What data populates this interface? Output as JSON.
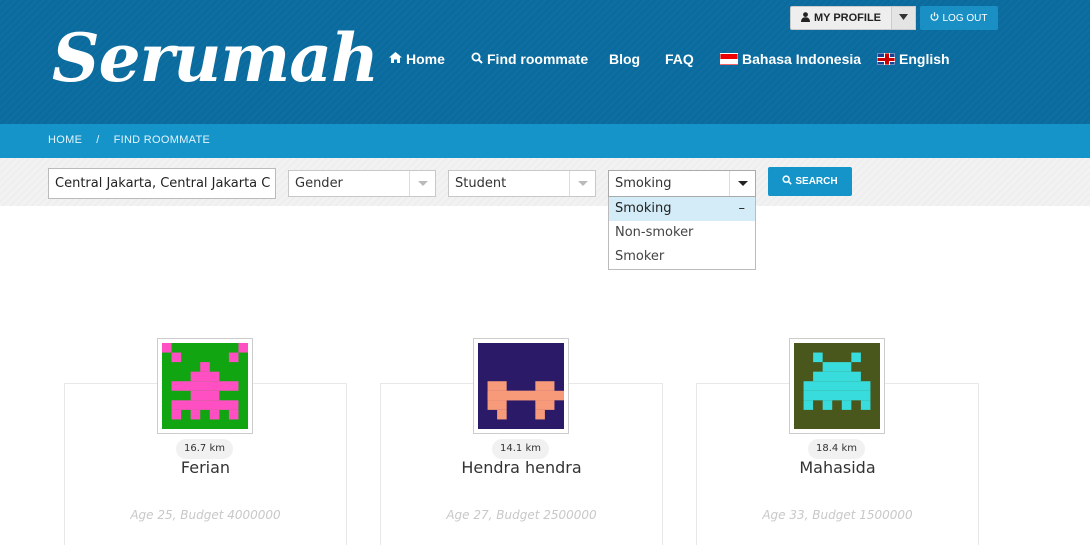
{
  "brand": {
    "logo": "Serumah"
  },
  "account": {
    "profile_label": "MY PROFILE",
    "logout_label": "LOG OUT"
  },
  "nav": {
    "home": "Home",
    "find": "Find roommate",
    "blog": "Blog",
    "faq": "FAQ",
    "lang_id": "Bahasa Indonesia",
    "lang_en": "English"
  },
  "breadcrumb": {
    "home": "HOME",
    "sep": "/",
    "current": "FIND ROOMMATE"
  },
  "filters": {
    "location_value": "Central Jakarta, Central Jakarta C",
    "gender": "Gender",
    "occupation": "Student",
    "smoking": "Smoking",
    "search_label": "SEARCH",
    "smoking_options": [
      "Smoking",
      "Non-smoker",
      "Smoker"
    ],
    "smoking_active_mark": "–"
  },
  "profiles": [
    {
      "name": "Ferian",
      "distance": "16.7 km",
      "meta": "Age 25, Budget 4000000",
      "avatar_bg": "#12a512",
      "avatar_fg": "#ff4fc2"
    },
    {
      "name": "Hendra hendra",
      "distance": "14.1 km",
      "meta": "Age 27, Budget 2500000",
      "avatar_bg": "#2a1a68",
      "avatar_fg": "#f79a7a"
    },
    {
      "name": "Mahasida",
      "distance": "18.4 km",
      "meta": "Age 33, Budget 1500000",
      "avatar_bg": "#49561c",
      "avatar_fg": "#39dcdc"
    }
  ],
  "colors": {
    "header": "#0a6b9e",
    "accent": "#1494c9"
  }
}
